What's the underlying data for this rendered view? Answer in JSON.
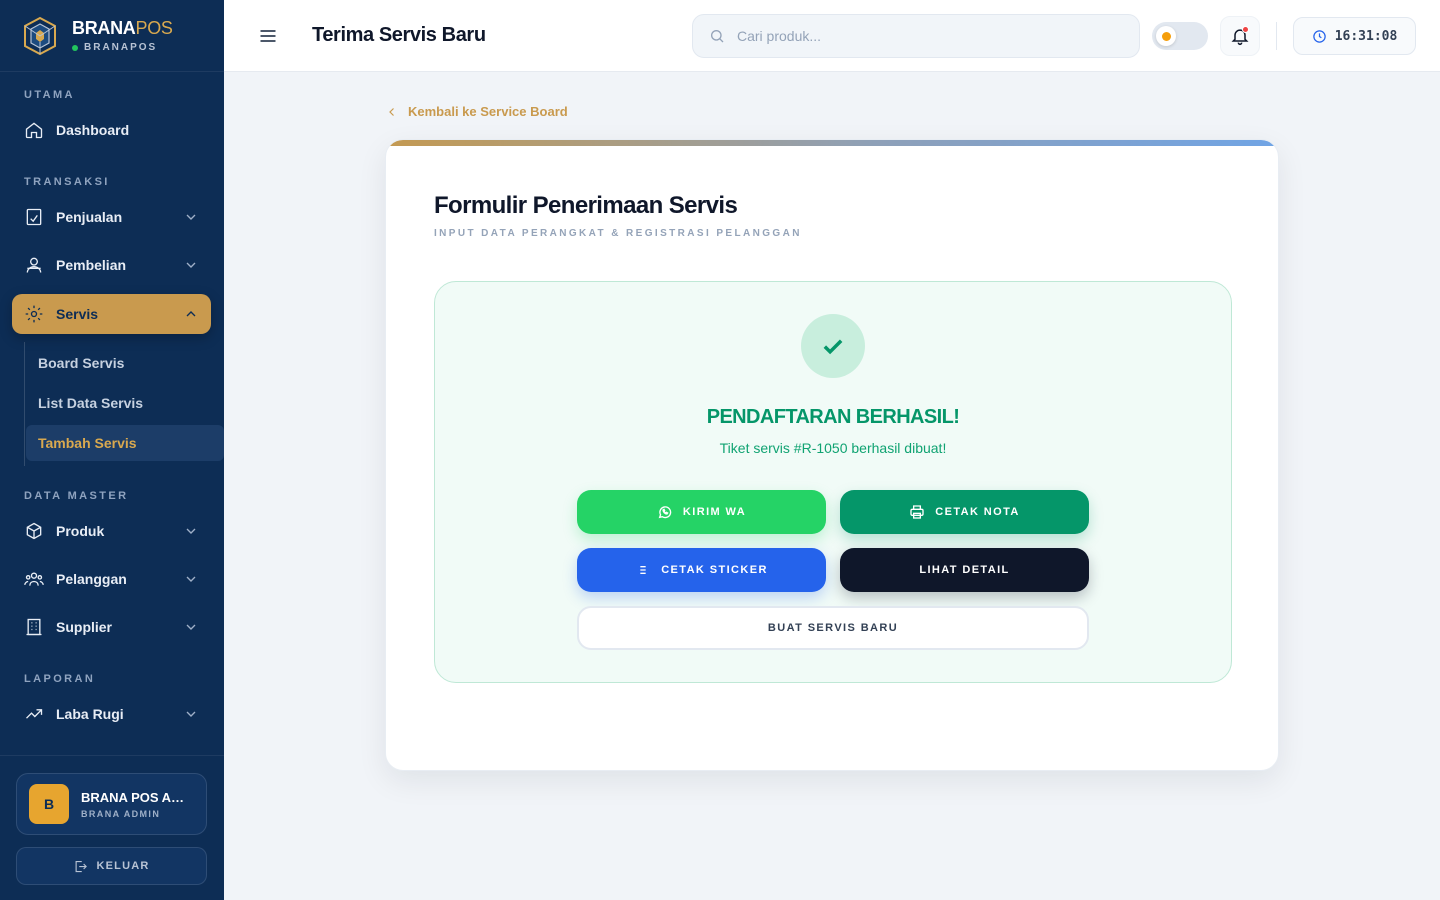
{
  "brand": {
    "name": "BRANA",
    "name_accent": "POS",
    "subtitle": "BRANAPOS"
  },
  "sidebar": {
    "sections": {
      "utama": "UTAMA",
      "transaksi": "TRANSAKSI",
      "data_master": "DATA MASTER",
      "laporan": "LAPORAN"
    },
    "items": {
      "dashboard": "Dashboard",
      "penjualan": "Penjualan",
      "pembelian": "Pembelian",
      "servis": "Servis",
      "produk": "Produk",
      "pelanggan": "Pelanggan",
      "supplier": "Supplier",
      "laba_rugi": "Laba Rugi"
    },
    "servis_sub": [
      "Board Servis",
      "List Data Servis",
      "Tambah Servis"
    ],
    "user": {
      "initial": "B",
      "name": "BRANA POS ADMIN",
      "role": "BRANA ADMIN"
    },
    "logout_label": "KELUAR"
  },
  "header": {
    "title": "Terima Servis Baru",
    "search_placeholder": "Cari produk...",
    "clock": "16:31:08"
  },
  "main": {
    "back_label": "Kembali ke Service Board",
    "form_title": "Formulir Penerimaan Servis",
    "form_subtitle": "INPUT DATA PERANGKAT & REGISTRASI PELANGGAN",
    "success": {
      "title": "PENDAFTARAN BERHASIL!",
      "message": "Tiket servis #R-1050 berhasil dibuat!",
      "buttons": {
        "wa": "KIRIM WA",
        "nota": "CETAK NOTA",
        "sticker": "CETAK STICKER",
        "detail": "LIHAT DETAIL",
        "new": "BUAT SERVIS BARU"
      }
    }
  }
}
